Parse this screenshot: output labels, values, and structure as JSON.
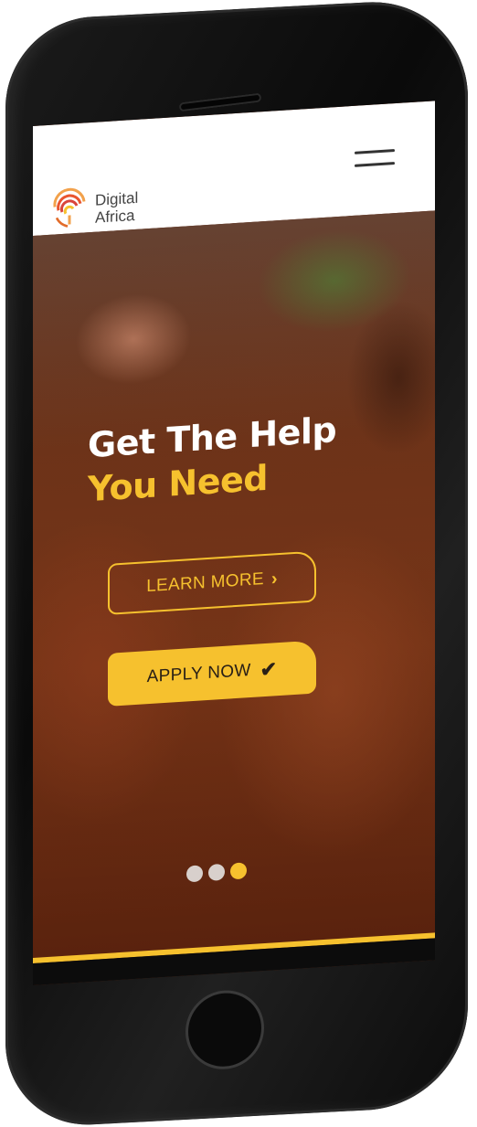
{
  "brand": {
    "name_line1": "Digital",
    "name_line2": "Africa"
  },
  "hero": {
    "headline_line1": "Get The Help",
    "headline_line2": "You Need",
    "learn_more_label": "LEARN MORE",
    "apply_now_label": "APPLY NOW"
  },
  "carousel": {
    "slide_count": 3,
    "active_index": 2
  },
  "colors": {
    "accent": "#f6c12e",
    "header_bg": "#ffffff",
    "headline_white": "#ffffff"
  },
  "icons": {
    "menu": "hamburger-icon",
    "learn_more": "chevron-right-icon",
    "apply_now": "checkmark-icon"
  }
}
